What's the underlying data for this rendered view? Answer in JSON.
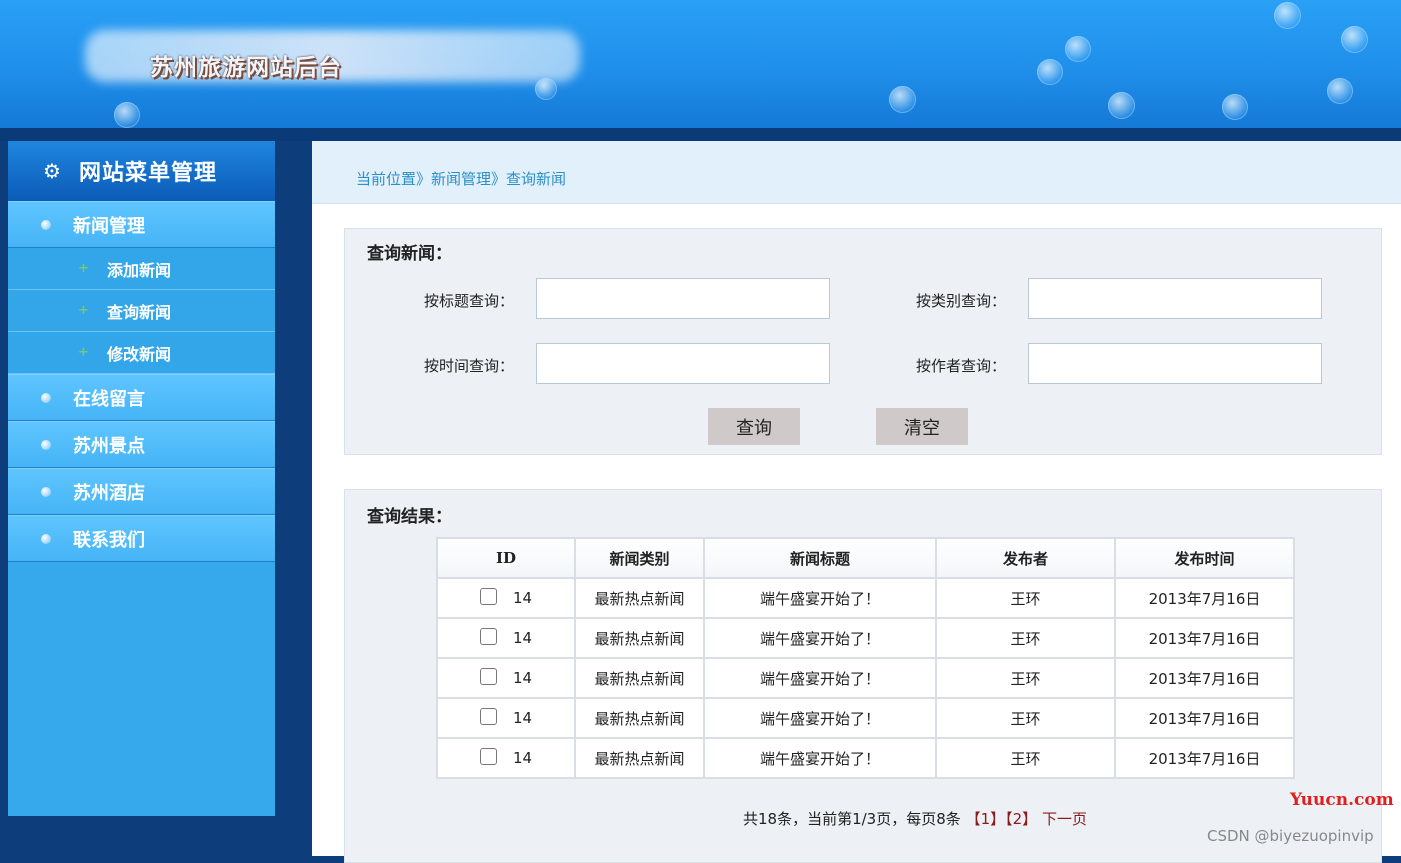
{
  "header": {
    "title": "苏州旅游网站后台"
  },
  "sidebar": {
    "title": "网站菜单管理",
    "menu": [
      {
        "label": "新闻管理",
        "subitems": [
          "添加新闻",
          "查询新闻",
          "修改新闻"
        ]
      },
      {
        "label": "在线留言"
      },
      {
        "label": "苏州景点"
      },
      {
        "label": "苏州酒店"
      },
      {
        "label": "联系我们"
      }
    ]
  },
  "breadcrumb": "当前位置》新闻管理》查询新闻",
  "search": {
    "title": "查询新闻：",
    "by_title_label": "按标题查询：",
    "by_category_label": "按类别查询：",
    "by_time_label": "按时间查询：",
    "by_author_label": "按作者查询：",
    "search_button": "查询",
    "clear_button": "清空"
  },
  "results": {
    "title": "查询结果：",
    "columns": [
      "ID",
      "新闻类别",
      "新闻标题",
      "发布者",
      "发布时间"
    ],
    "rows": [
      {
        "id": "14",
        "category": "最新热点新闻",
        "title": "端午盛宴开始了！",
        "author": "王环",
        "date": "2013年7月16日"
      },
      {
        "id": "14",
        "category": "最新热点新闻",
        "title": "端午盛宴开始了！",
        "author": "王环",
        "date": "2013年7月16日"
      },
      {
        "id": "14",
        "category": "最新热点新闻",
        "title": "端午盛宴开始了！",
        "author": "王环",
        "date": "2013年7月16日"
      },
      {
        "id": "14",
        "category": "最新热点新闻",
        "title": "端午盛宴开始了！",
        "author": "王环",
        "date": "2013年7月16日"
      },
      {
        "id": "14",
        "category": "最新热点新闻",
        "title": "端午盛宴开始了！",
        "author": "王环",
        "date": "2013年7月16日"
      }
    ],
    "pager": {
      "summary": "共18条，当前第1/3页，每页8条",
      "page1": "【1】",
      "page2": "【2】",
      "next": "下一页"
    }
  },
  "watermarks": {
    "site": "Yuucn.com",
    "csdn": "CSDN @biyezuopinvip"
  },
  "icons": {
    "menu_head": "gear-icon",
    "menu_bullet": "bullet-dot-icon",
    "sub_bullet": "plus-icon"
  }
}
